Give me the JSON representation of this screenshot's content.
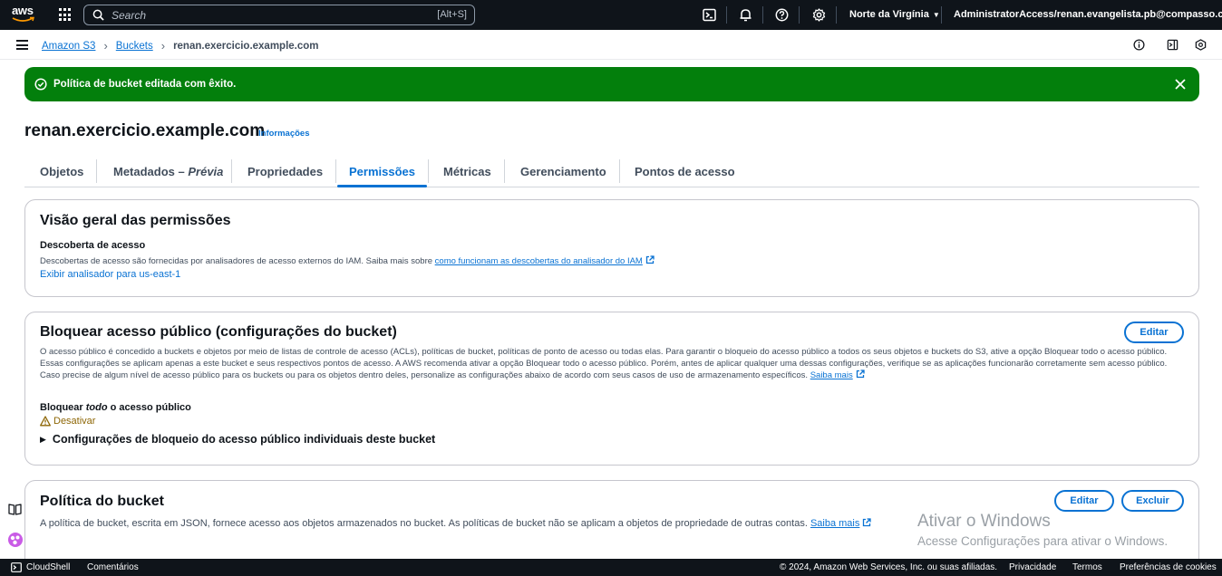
{
  "topbar": {
    "logo_text": "aws",
    "search_placeholder": "Search",
    "search_shortcut": "[Alt+S]",
    "region": "Norte da Virgínia",
    "account": "AdministratorAccess/renan.evangelista.pb@compasso.com.br"
  },
  "breadcrumb": {
    "items": [
      "Amazon S3",
      "Buckets"
    ],
    "current": "renan.exercicio.example.com"
  },
  "flash": {
    "message": "Política de bucket editada com êxito.",
    "color": "#037f0c"
  },
  "page": {
    "title": "renan.exercicio.example.com",
    "info_link": "Informações"
  },
  "tabs": [
    {
      "label": "Objetos"
    },
    {
      "label": "Metadados – ",
      "label_em": "Prévia"
    },
    {
      "label": "Propriedades"
    },
    {
      "label": "Permissões",
      "active": true
    },
    {
      "label": "Métricas"
    },
    {
      "label": "Gerenciamento"
    },
    {
      "label": "Pontos de acesso"
    }
  ],
  "overview": {
    "title": "Visão geral das permissões",
    "subtitle": "Descoberta de acesso",
    "description": "Descobertas de acesso são fornecidas por analisadores de acesso externos do IAM. Saiba mais sobre ",
    "description_link": "como funcionam as descobertas do analisador do IAM",
    "analyzer_link": "Exibir analisador para us-east-1"
  },
  "block_public": {
    "title": "Bloquear acesso público (configurações do bucket)",
    "edit_button": "Editar",
    "description": "O acesso público é concedido a buckets e objetos por meio de listas de controle de acesso (ACLs), políticas de bucket, políticas de ponto de acesso ou todas elas. Para garantir o bloqueio do acesso público a todos os seus objetos e buckets do S3, ative a opção Bloquear todo o acesso público. Essas configurações se aplicam apenas a este bucket e seus respectivos pontos de acesso. A AWS recomenda ativar a opção Bloquear todo o acesso público. Porém, antes de aplicar qualquer uma dessas configurações, verifique se as aplicações funcionarão corretamente sem acesso público. Caso precise de algum nível de acesso público para os buckets ou para os objetos dentro deles, personalize as configurações abaixo de acordo com seus casos de uso de armazenamento específicos. ",
    "learn_more": "Saiba mais",
    "block_all_prefix": "Bloquear ",
    "block_all_em": "todo",
    "block_all_suffix": " o acesso público",
    "status": "Desativar",
    "expander": "Configurações de bloqueio do acesso público individuais deste bucket"
  },
  "policy": {
    "title": "Política do bucket",
    "edit_button": "Editar",
    "delete_button": "Excluir",
    "description": "A política de bucket, escrita em JSON, fornece acesso aos objetos armazenados no bucket. As políticas de bucket não se aplicam a objetos de propriedade de outras contas. ",
    "learn_more": "Saiba mais"
  },
  "watermark": {
    "line1": "Ativar o Windows",
    "line2": "Acesse Configurações para ativar o Windows."
  },
  "footer": {
    "cloudshell": "CloudShell",
    "feedback": "Comentários",
    "copyright": "© 2024, Amazon Web Services, Inc. ou suas afiliadas.",
    "privacy": "Privacidade",
    "terms": "Termos",
    "cookies": "Preferências de cookies"
  }
}
